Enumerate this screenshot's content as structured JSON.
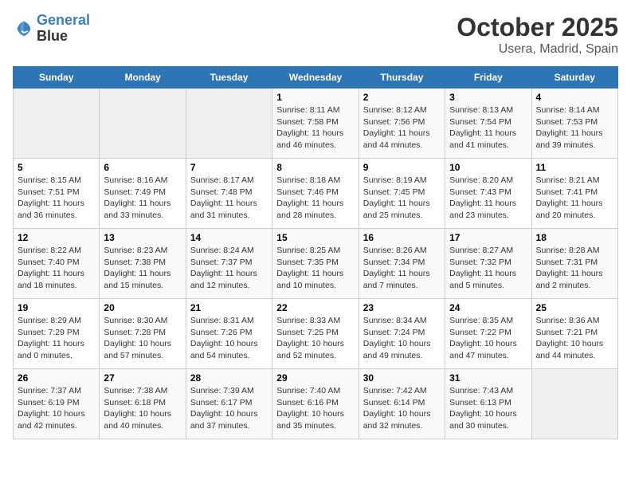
{
  "header": {
    "logo_line1": "General",
    "logo_line2": "Blue",
    "title": "October 2025",
    "subtitle": "Usera, Madrid, Spain"
  },
  "weekdays": [
    "Sunday",
    "Monday",
    "Tuesday",
    "Wednesday",
    "Thursday",
    "Friday",
    "Saturday"
  ],
  "weeks": [
    [
      {
        "day": "",
        "info": ""
      },
      {
        "day": "",
        "info": ""
      },
      {
        "day": "",
        "info": ""
      },
      {
        "day": "1",
        "info": "Sunrise: 8:11 AM\nSunset: 7:58 PM\nDaylight: 11 hours and 46 minutes."
      },
      {
        "day": "2",
        "info": "Sunrise: 8:12 AM\nSunset: 7:56 PM\nDaylight: 11 hours and 44 minutes."
      },
      {
        "day": "3",
        "info": "Sunrise: 8:13 AM\nSunset: 7:54 PM\nDaylight: 11 hours and 41 minutes."
      },
      {
        "day": "4",
        "info": "Sunrise: 8:14 AM\nSunset: 7:53 PM\nDaylight: 11 hours and 39 minutes."
      }
    ],
    [
      {
        "day": "5",
        "info": "Sunrise: 8:15 AM\nSunset: 7:51 PM\nDaylight: 11 hours and 36 minutes."
      },
      {
        "day": "6",
        "info": "Sunrise: 8:16 AM\nSunset: 7:49 PM\nDaylight: 11 hours and 33 minutes."
      },
      {
        "day": "7",
        "info": "Sunrise: 8:17 AM\nSunset: 7:48 PM\nDaylight: 11 hours and 31 minutes."
      },
      {
        "day": "8",
        "info": "Sunrise: 8:18 AM\nSunset: 7:46 PM\nDaylight: 11 hours and 28 minutes."
      },
      {
        "day": "9",
        "info": "Sunrise: 8:19 AM\nSunset: 7:45 PM\nDaylight: 11 hours and 25 minutes."
      },
      {
        "day": "10",
        "info": "Sunrise: 8:20 AM\nSunset: 7:43 PM\nDaylight: 11 hours and 23 minutes."
      },
      {
        "day": "11",
        "info": "Sunrise: 8:21 AM\nSunset: 7:41 PM\nDaylight: 11 hours and 20 minutes."
      }
    ],
    [
      {
        "day": "12",
        "info": "Sunrise: 8:22 AM\nSunset: 7:40 PM\nDaylight: 11 hours and 18 minutes."
      },
      {
        "day": "13",
        "info": "Sunrise: 8:23 AM\nSunset: 7:38 PM\nDaylight: 11 hours and 15 minutes."
      },
      {
        "day": "14",
        "info": "Sunrise: 8:24 AM\nSunset: 7:37 PM\nDaylight: 11 hours and 12 minutes."
      },
      {
        "day": "15",
        "info": "Sunrise: 8:25 AM\nSunset: 7:35 PM\nDaylight: 11 hours and 10 minutes."
      },
      {
        "day": "16",
        "info": "Sunrise: 8:26 AM\nSunset: 7:34 PM\nDaylight: 11 hours and 7 minutes."
      },
      {
        "day": "17",
        "info": "Sunrise: 8:27 AM\nSunset: 7:32 PM\nDaylight: 11 hours and 5 minutes."
      },
      {
        "day": "18",
        "info": "Sunrise: 8:28 AM\nSunset: 7:31 PM\nDaylight: 11 hours and 2 minutes."
      }
    ],
    [
      {
        "day": "19",
        "info": "Sunrise: 8:29 AM\nSunset: 7:29 PM\nDaylight: 11 hours and 0 minutes."
      },
      {
        "day": "20",
        "info": "Sunrise: 8:30 AM\nSunset: 7:28 PM\nDaylight: 10 hours and 57 minutes."
      },
      {
        "day": "21",
        "info": "Sunrise: 8:31 AM\nSunset: 7:26 PM\nDaylight: 10 hours and 54 minutes."
      },
      {
        "day": "22",
        "info": "Sunrise: 8:33 AM\nSunset: 7:25 PM\nDaylight: 10 hours and 52 minutes."
      },
      {
        "day": "23",
        "info": "Sunrise: 8:34 AM\nSunset: 7:24 PM\nDaylight: 10 hours and 49 minutes."
      },
      {
        "day": "24",
        "info": "Sunrise: 8:35 AM\nSunset: 7:22 PM\nDaylight: 10 hours and 47 minutes."
      },
      {
        "day": "25",
        "info": "Sunrise: 8:36 AM\nSunset: 7:21 PM\nDaylight: 10 hours and 44 minutes."
      }
    ],
    [
      {
        "day": "26",
        "info": "Sunrise: 7:37 AM\nSunset: 6:19 PM\nDaylight: 10 hours and 42 minutes."
      },
      {
        "day": "27",
        "info": "Sunrise: 7:38 AM\nSunset: 6:18 PM\nDaylight: 10 hours and 40 minutes."
      },
      {
        "day": "28",
        "info": "Sunrise: 7:39 AM\nSunset: 6:17 PM\nDaylight: 10 hours and 37 minutes."
      },
      {
        "day": "29",
        "info": "Sunrise: 7:40 AM\nSunset: 6:16 PM\nDaylight: 10 hours and 35 minutes."
      },
      {
        "day": "30",
        "info": "Sunrise: 7:42 AM\nSunset: 6:14 PM\nDaylight: 10 hours and 32 minutes."
      },
      {
        "day": "31",
        "info": "Sunrise: 7:43 AM\nSunset: 6:13 PM\nDaylight: 10 hours and 30 minutes."
      },
      {
        "day": "",
        "info": ""
      }
    ]
  ]
}
